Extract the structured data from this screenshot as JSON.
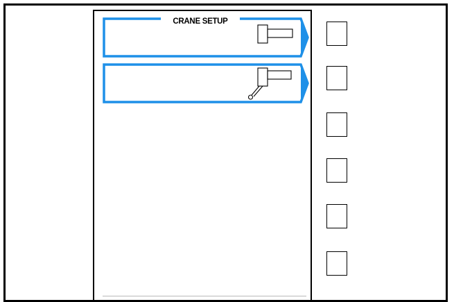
{
  "screen": {
    "title": "CRANE SETUP"
  },
  "menu_items": [
    {
      "id": "boom-retracted",
      "icon": "crane-boom-icon",
      "label": ""
    },
    {
      "id": "boom-with-hook",
      "icon": "crane-boom-hook-icon",
      "label": ""
    }
  ],
  "side_buttons": [
    {
      "id": "soft-key-1",
      "label": ""
    },
    {
      "id": "soft-key-2",
      "label": ""
    },
    {
      "id": "soft-key-3",
      "label": ""
    },
    {
      "id": "soft-key-4",
      "label": ""
    },
    {
      "id": "soft-key-5",
      "label": ""
    },
    {
      "id": "soft-key-6",
      "label": ""
    }
  ],
  "colors": {
    "accent": "#1e90e8",
    "frame": "#000000",
    "background": "#ffffff"
  }
}
